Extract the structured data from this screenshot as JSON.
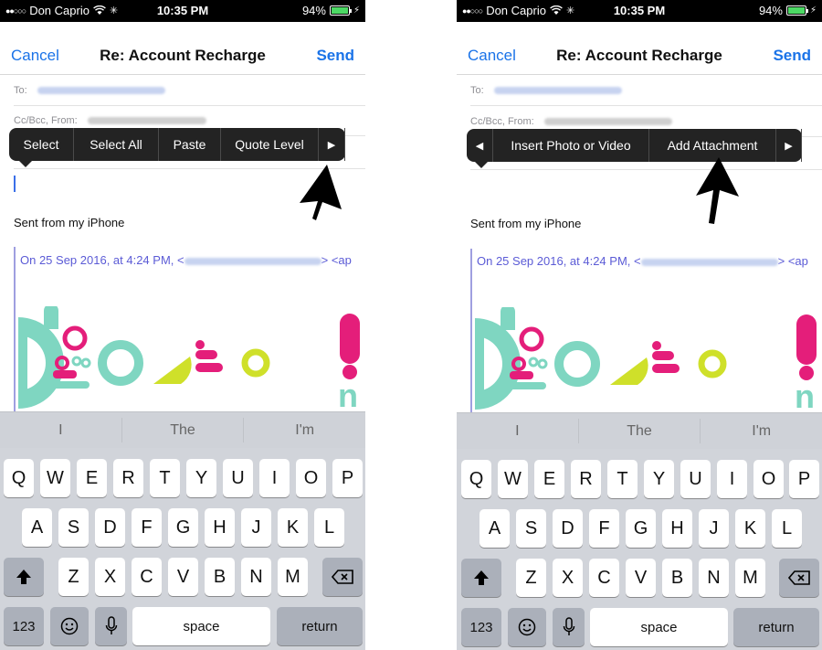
{
  "status": {
    "carrier": "Don Caprio",
    "signal_dots": "●●○○○",
    "time": "10:35 PM",
    "battery": "94%",
    "battery_level": 0.94
  },
  "nav": {
    "cancel": "Cancel",
    "title": "Re: Account Recharge",
    "send": "Send"
  },
  "fields": {
    "to_label": "To:",
    "ccbcc_label": "Cc/Bcc, From:"
  },
  "body": {
    "signature": "Sent from my iPhone",
    "quote_header": "On 25 Sep 2016, at 4:24 PM, <",
    "quote_header_tail": "> <ap"
  },
  "menu_left": {
    "items": [
      "Select",
      "Select All",
      "Paste",
      "Quote Level"
    ],
    "next_arrow": "▶"
  },
  "menu_right": {
    "prev_arrow": "◀",
    "items": [
      "Insert Photo or Video",
      "Add Attachment"
    ],
    "next_arrow": "▶"
  },
  "keyboard": {
    "suggestions": [
      "I",
      "The",
      "I'm"
    ],
    "row1": [
      "Q",
      "W",
      "E",
      "R",
      "T",
      "Y",
      "U",
      "I",
      "O",
      "P"
    ],
    "row2": [
      "A",
      "S",
      "D",
      "F",
      "G",
      "H",
      "J",
      "K",
      "L"
    ],
    "row3": [
      "Z",
      "X",
      "C",
      "V",
      "B",
      "N",
      "M"
    ],
    "numbers": "123",
    "space": "space",
    "return": "return",
    "shift_icon": "shift-icon",
    "delete_icon": "delete-icon",
    "emoji_icon": "emoji-icon",
    "mic_icon": "microphone-icon"
  },
  "colors": {
    "accent": "#1a73e8",
    "menu_bg": "#232323",
    "keyboard_bg": "#d1d4da",
    "quote_text": "#5b5bd6"
  }
}
